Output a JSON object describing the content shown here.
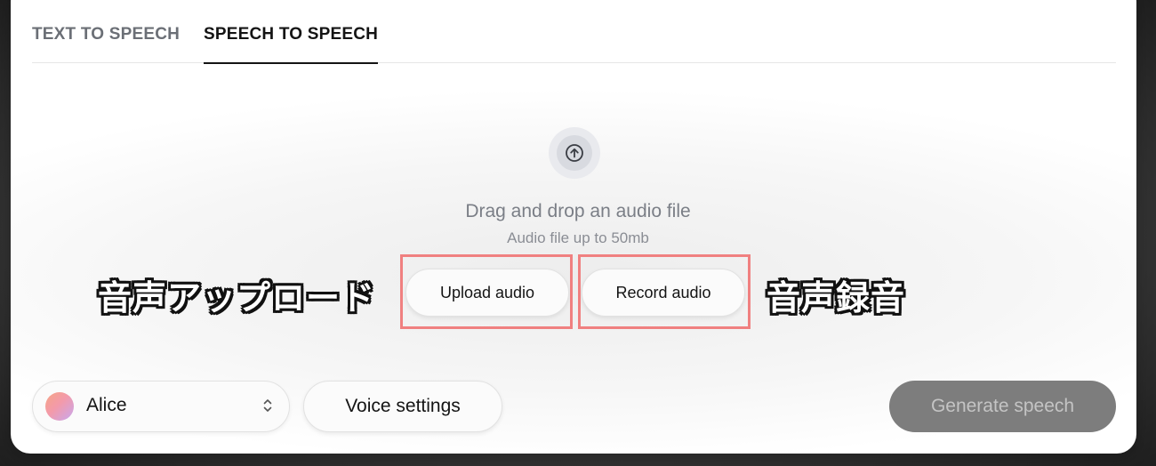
{
  "tabs": {
    "text_to_speech": "TEXT TO SPEECH",
    "speech_to_speech": "SPEECH TO SPEECH",
    "active": "speech_to_speech"
  },
  "dropzone": {
    "icon": "upload-arrow-icon",
    "title": "Drag and drop an audio file",
    "subtitle": "Audio file up to 50mb"
  },
  "actions": {
    "upload_label": "Upload audio",
    "record_label": "Record audio"
  },
  "annotations": {
    "upload_note": "音声アップロード",
    "record_note": "音声録音",
    "highlight_color": "#f08080"
  },
  "footer": {
    "voice_name": "Alice",
    "voice_settings_label": "Voice settings",
    "generate_label": "Generate speech"
  }
}
